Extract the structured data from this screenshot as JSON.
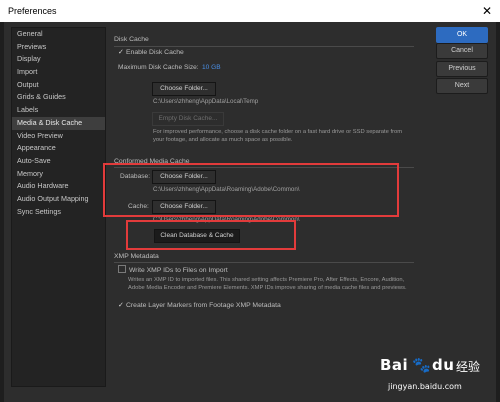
{
  "window": {
    "title": "Preferences"
  },
  "sidebar": {
    "items": [
      {
        "label": "General"
      },
      {
        "label": "Previews"
      },
      {
        "label": "Display"
      },
      {
        "label": "Import"
      },
      {
        "label": "Output"
      },
      {
        "label": "Grids & Guides"
      },
      {
        "label": "Labels"
      },
      {
        "label": "Media & Disk Cache",
        "active": true
      },
      {
        "label": "Video Preview"
      },
      {
        "label": "Appearance"
      },
      {
        "label": "Auto-Save"
      },
      {
        "label": "Memory"
      },
      {
        "label": "Audio Hardware"
      },
      {
        "label": "Audio Output Mapping"
      },
      {
        "label": "Sync Settings"
      }
    ]
  },
  "buttons": {
    "ok": "OK",
    "cancel": "Cancel",
    "previous": "Previous",
    "next": "Next"
  },
  "disk_cache": {
    "heading": "Disk Cache",
    "enable_label": "Enable Disk Cache",
    "max_size_label": "Maximum Disk Cache Size:",
    "max_size_value": "10 GB",
    "choose_folder": "Choose Folder...",
    "path": "C:\\Users\\zhheng\\AppData\\Local\\Temp",
    "empty_cache": "Empty Disk Cache...",
    "note": "For improved performance, choose a disk cache folder on a fast hard drive or SSD separate from your footage, and allocate as much space as possible."
  },
  "conformed_cache": {
    "heading": "Conformed Media Cache",
    "database_label": "Database:",
    "database_button": "Choose Folder...",
    "database_path": "C:\\Users\\zhheng\\AppData\\Roaming\\Adobe\\Common\\",
    "cache_label": "Cache:",
    "cache_button": "Choose Folder...",
    "cache_path": "C:\\Users\\zhheng\\AppData\\Roaming\\Adobe\\Common\\",
    "clean_button": "Clean Database & Cache"
  },
  "xmp": {
    "heading": "XMP Metadata",
    "write_ids_label": "Write XMP IDs to Files on Import",
    "write_ids_note": "Writes an XMP ID to imported files. This shared setting affects Premiere Pro, After Effects, Encore, Audition, Adobe Media Encoder and Premiere Elements. XMP IDs improve sharing of media cache files and previews.",
    "layer_markers_label": "Create Layer Markers from Footage XMP Metadata"
  },
  "watermark": {
    "brand": "Bai",
    "brand2": "经验",
    "url": "jingyan.baidu.com"
  }
}
